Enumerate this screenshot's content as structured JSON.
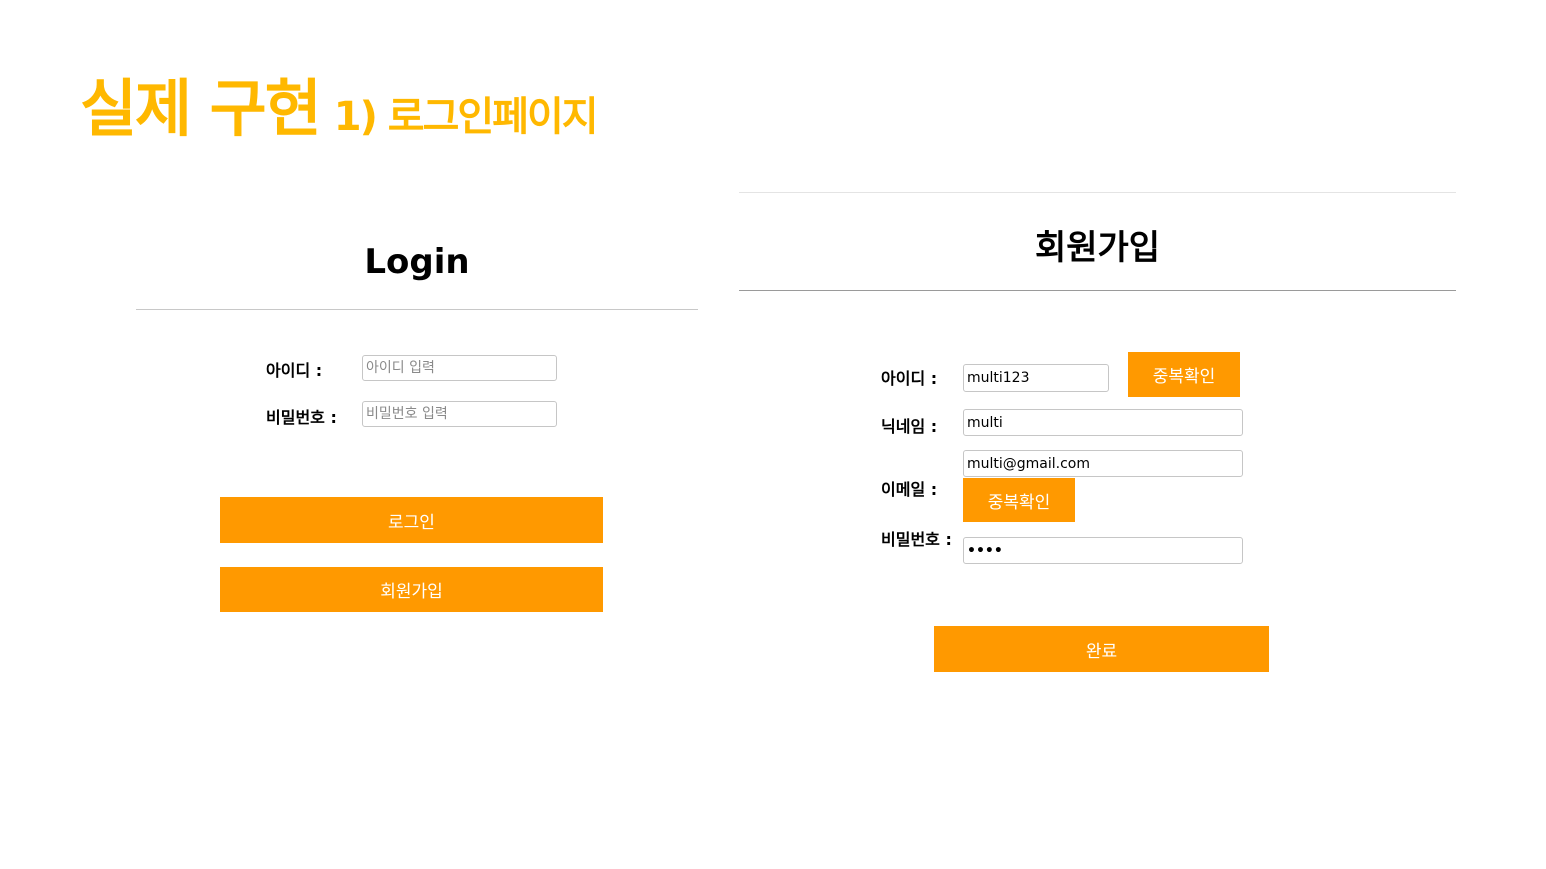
{
  "slide": {
    "title_main": "실제 구현",
    "title_sub": "1) 로그인페이지"
  },
  "login": {
    "heading": "Login",
    "id_label": "아이디 :",
    "id_placeholder": "아이디 입력",
    "pw_label": "비밀번호 :",
    "pw_placeholder": "비밀번호 입력",
    "login_button": "로그인",
    "signup_button": "회원가입"
  },
  "signup": {
    "heading": "회원가입",
    "id_label": "아이디 :",
    "id_value": "multi123",
    "dup_check_button": "중복확인",
    "nickname_label": "닉네임 :",
    "nickname_value": "multi",
    "email_label": "이메일 :",
    "email_value": "multi@gmail.com",
    "email_dup_check_button": "중복확인",
    "password_label": "비밀번호 :",
    "password_value": "••••",
    "submit_button": "완료"
  },
  "colors": {
    "title": "#FFB800",
    "button": "#FF9900"
  }
}
